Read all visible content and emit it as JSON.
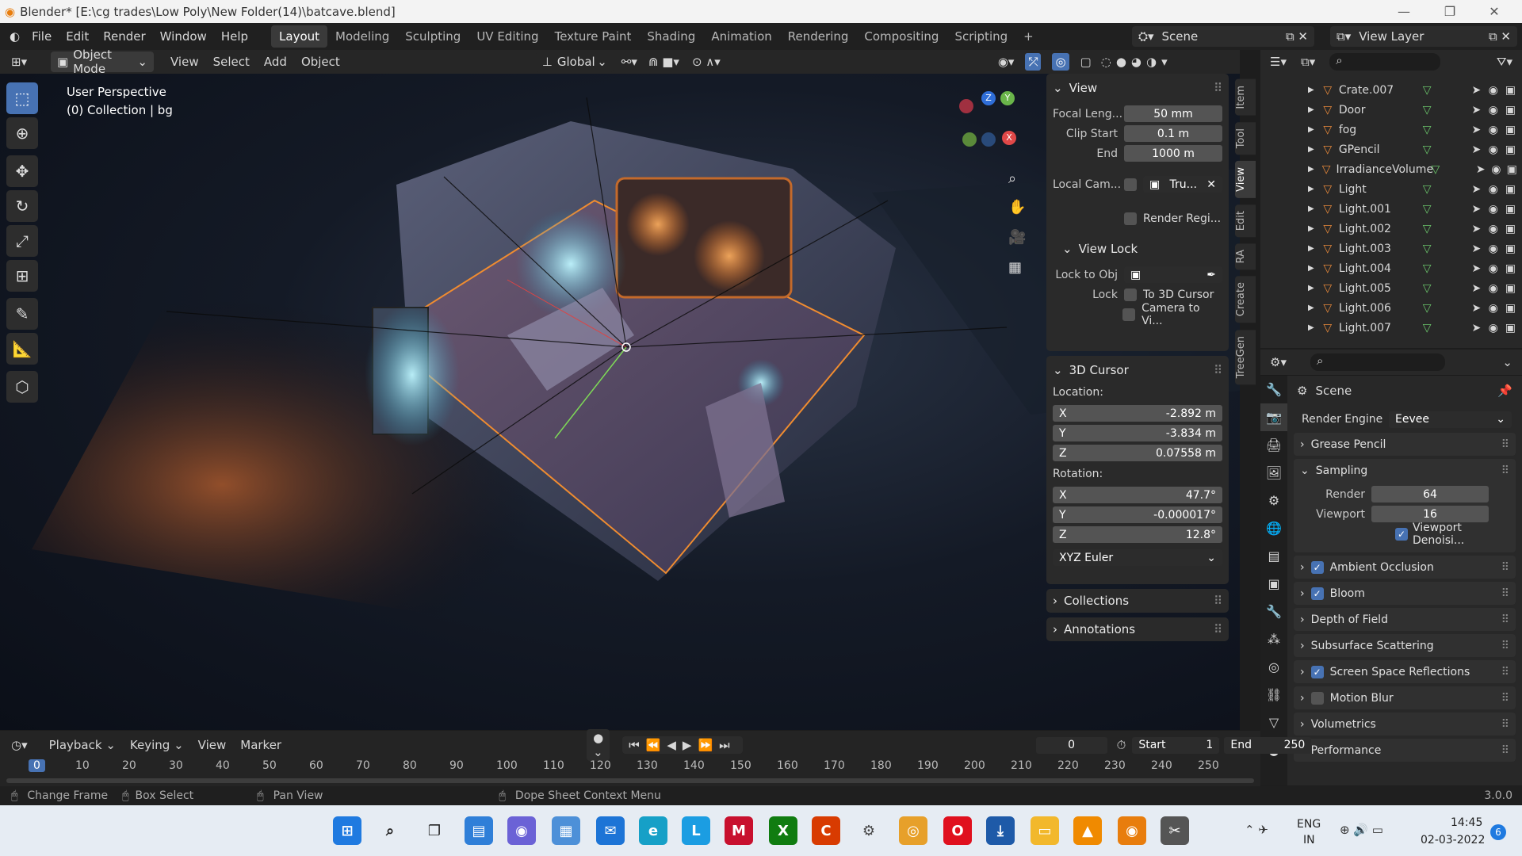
{
  "title": "Blender* [E:\\cg trades\\Low Poly\\New Folder(14)\\batcave.blend]",
  "menu": [
    "File",
    "Edit",
    "Render",
    "Window",
    "Help"
  ],
  "workspaces": [
    "Layout",
    "Modeling",
    "Sculpting",
    "UV Editing",
    "Texture Paint",
    "Shading",
    "Animation",
    "Rendering",
    "Compositing",
    "Scripting"
  ],
  "scene": "Scene",
  "view_layer": "View Layer",
  "header": {
    "mode": "Object Mode",
    "view": "View",
    "select": "Select",
    "add": "Add",
    "object": "Object",
    "orientation": "Global"
  },
  "viewport": {
    "perspective": "User Perspective",
    "collection": "(0) Collection | bg"
  },
  "npanel": {
    "view_title": "View",
    "focal_label": "Focal Leng...",
    "focal": "50 mm",
    "clip_start_label": "Clip Start",
    "clip_start": "0.1 m",
    "end_label": "End",
    "end": "1000 m",
    "local_cam_label": "Local Cam...",
    "local_cam": "Tru...",
    "render_region": "Render Regi...",
    "view_lock": "View Lock",
    "lock_to_obj": "Lock to Obj",
    "lock_label": "Lock",
    "to_3d_cursor": "To 3D Cursor",
    "camera_to_view": "Camera to Vi...",
    "cursor_title": "3D Cursor",
    "location": "Location:",
    "loc_x": "-2.892 m",
    "loc_y": "-3.834 m",
    "loc_z": "0.07558 m",
    "rotation": "Rotation:",
    "rot_x": "47.7°",
    "rot_y": "-0.000017°",
    "rot_z": "12.8°",
    "rot_mode": "XYZ Euler",
    "collections": "Collections",
    "annotations": "Annotations"
  },
  "ntabs": [
    "Item",
    "Tool",
    "View",
    "Edit",
    "RA",
    "Create",
    "TreeGen"
  ],
  "outliner": [
    "Crate.007",
    "Door",
    "fog",
    "GPencil",
    "IrradianceVolume",
    "Light",
    "Light.001",
    "Light.002",
    "Light.003",
    "Light.004",
    "Light.005",
    "Light.006",
    "Light.007"
  ],
  "props": {
    "scene": "Scene",
    "render_engine_label": "Render Engine",
    "render_engine": "Eevee",
    "grease_pencil": "Grease Pencil",
    "sampling": "Sampling",
    "render_label": "Render",
    "render": "64",
    "viewport_label": "Viewport",
    "viewport": "16",
    "viewport_denoise": "Viewport Denoisi...",
    "sections": [
      {
        "label": "Ambient Occlusion",
        "check": true
      },
      {
        "label": "Bloom",
        "check": true
      },
      {
        "label": "Depth of Field",
        "check": null
      },
      {
        "label": "Subsurface Scattering",
        "check": null
      },
      {
        "label": "Screen Space Reflections",
        "check": true
      },
      {
        "label": "Motion Blur",
        "check": false
      },
      {
        "label": "Volumetrics",
        "check": null
      },
      {
        "label": "Performance",
        "check": null
      }
    ]
  },
  "timeline": {
    "playback": "Playback",
    "keying": "Keying",
    "view": "View",
    "marker": "Marker",
    "frame": "0",
    "start_label": "Start",
    "start": "1",
    "end_label": "End",
    "end": "250",
    "ticks": [
      "0",
      "10",
      "20",
      "30",
      "40",
      "50",
      "60",
      "70",
      "80",
      "90",
      "100",
      "110",
      "120",
      "130",
      "140",
      "150",
      "160",
      "170",
      "180",
      "190",
      "200",
      "210",
      "220",
      "230",
      "240",
      "250"
    ]
  },
  "status": {
    "change_frame": "Change Frame",
    "box_select": "Box Select",
    "pan_view": "Pan View",
    "context": "Dope Sheet Context Menu",
    "version": "3.0.0"
  },
  "taskbar": {
    "lang1": "ENG",
    "lang2": "IN",
    "time": "14:45",
    "date": "02-03-2022",
    "badge": "6"
  },
  "colors": {
    "accent": "#4772b3",
    "active_tab": "#3a3a3a",
    "orange": "#e8893a"
  }
}
